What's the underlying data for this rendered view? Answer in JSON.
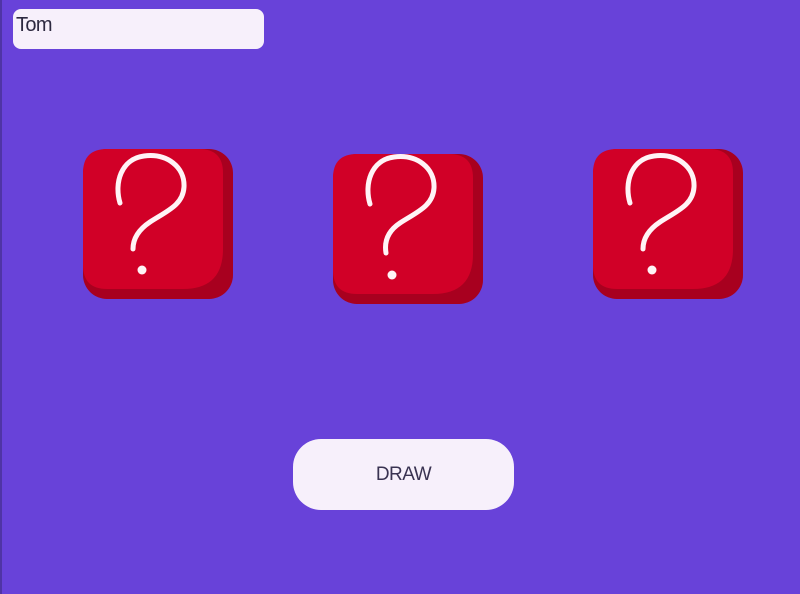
{
  "player": {
    "name": "Tom"
  },
  "cards": [
    {
      "face": "hidden",
      "icon": "question-mark-icon"
    },
    {
      "face": "hidden",
      "icon": "question-mark-icon"
    },
    {
      "face": "hidden",
      "icon": "question-mark-icon"
    }
  ],
  "actions": {
    "draw_label": "DRAW"
  },
  "colors": {
    "background": "#6842d9",
    "card_face": "#d10027",
    "card_shade": "#a8001f",
    "question_mark": "#fff3f6",
    "button_bg": "#f7f0fb",
    "input_bg": "#f7f0fb"
  }
}
